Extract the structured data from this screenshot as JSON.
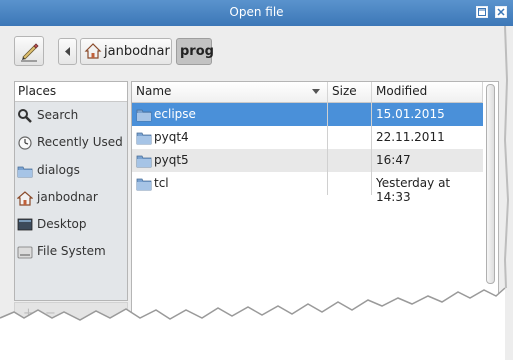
{
  "window": {
    "title": "Open file",
    "controls": {
      "restore_icon": "restore-icon",
      "close_icon": "close-icon"
    }
  },
  "toolbar": {
    "edit_icon": "pencil-icon",
    "back_icon": "chevron-left-icon",
    "breadcrumbs": [
      {
        "label": "janbodnar",
        "icon": "home-icon"
      },
      {
        "label": "prog",
        "active": true
      }
    ]
  },
  "places": {
    "header": "Places",
    "items": [
      {
        "label": "Search",
        "icon": "search-icon"
      },
      {
        "label": "Recently Used",
        "icon": "clock-icon"
      },
      {
        "label": "dialogs",
        "icon": "folder-icon"
      },
      {
        "label": "janbodnar",
        "icon": "home-icon"
      },
      {
        "label": "Desktop",
        "icon": "desktop-icon"
      },
      {
        "label": "File System",
        "icon": "drive-icon"
      }
    ],
    "add_label": "+",
    "remove_label": "−"
  },
  "files": {
    "columns": {
      "name": "Name",
      "size": "Size",
      "modified": "Modified"
    },
    "sort_icon": "sort-down-icon",
    "rows": [
      {
        "name": "eclipse",
        "size": "",
        "modified": "15.01.2015",
        "selected": true
      },
      {
        "name": "pyqt4",
        "size": "",
        "modified": "22.11.2011"
      },
      {
        "name": "pyqt5",
        "size": "",
        "modified": "16:47"
      },
      {
        "name": "tcl",
        "size": "",
        "modified": "Yesterday at 14:33"
      }
    ]
  },
  "colors": {
    "titlebar": "#4a86c6",
    "selection": "#4a90d9",
    "folder": "#7ba3d1"
  }
}
